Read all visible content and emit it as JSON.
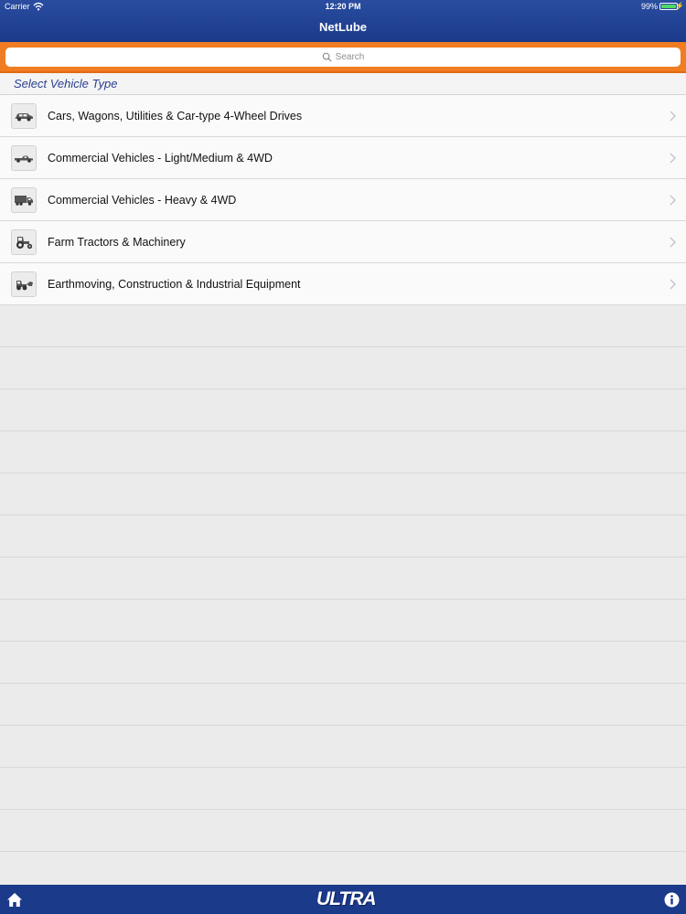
{
  "status_bar": {
    "carrier": "Carrier",
    "time": "12:20 PM",
    "battery": "99%",
    "battery_level": 0.99
  },
  "nav": {
    "title": "NetLube"
  },
  "search": {
    "placeholder": "Search"
  },
  "section": {
    "title": "Select Vehicle Type"
  },
  "vehicle_types": [
    {
      "label": "Cars, Wagons, Utilities & Car-type 4-Wheel Drives",
      "icon": "car-icon"
    },
    {
      "label": "Commercial Vehicles - Light/Medium & 4WD",
      "icon": "pickup-icon"
    },
    {
      "label": "Commercial Vehicles - Heavy & 4WD",
      "icon": "truck-icon"
    },
    {
      "label": "Farm Tractors & Machinery",
      "icon": "tractor-icon"
    },
    {
      "label": "Earthmoving, Construction & Industrial Equipment",
      "icon": "loader-icon"
    }
  ],
  "bottom_bar": {
    "logo": "ULTRA",
    "home_icon": "home-icon",
    "info_icon": "info-icon"
  },
  "colors": {
    "nav": "#1c3a8a",
    "search_bar": "#f07d22",
    "section_text": "#2a3f8f"
  }
}
